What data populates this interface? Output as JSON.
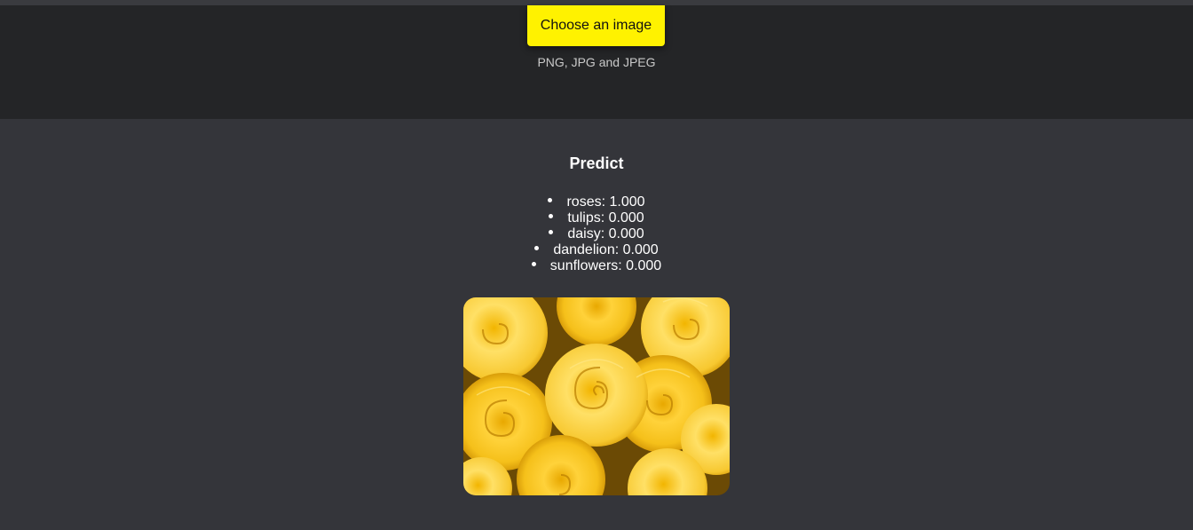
{
  "upload": {
    "button_label": "Choose an image",
    "formats_text": "PNG, JPG and JPEG"
  },
  "prediction": {
    "title": "Predict",
    "items": [
      {
        "label": "roses: 1.000"
      },
      {
        "label": "tulips: 0.000"
      },
      {
        "label": "daisy: 0.000"
      },
      {
        "label": "dandelion: 0.000"
      },
      {
        "label": "sunflowers: 0.000"
      }
    ]
  },
  "image": {
    "subject": "yellow roses bouquet"
  },
  "colors": {
    "page_background": "#34353a",
    "upload_background": "#242527",
    "button_background": "#fff200",
    "text_primary": "#ffffff",
    "text_secondary": "#c9c9c9"
  }
}
